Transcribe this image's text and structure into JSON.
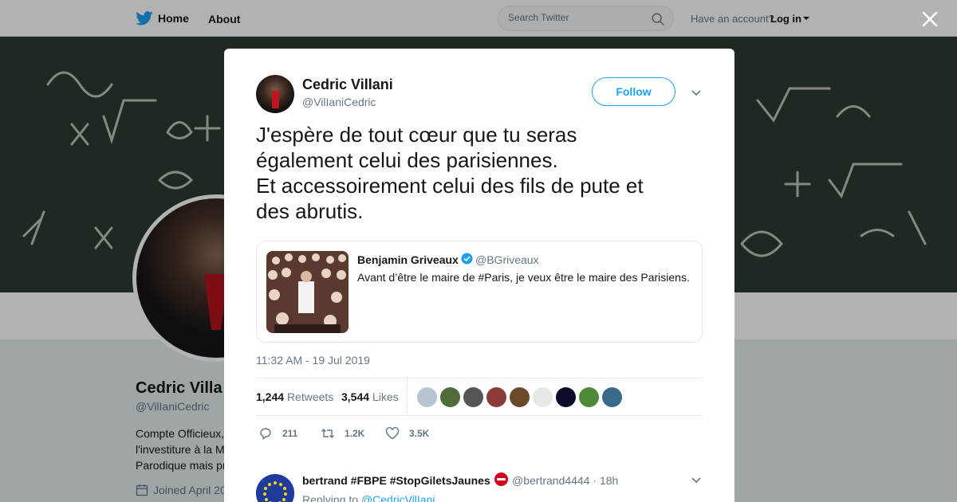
{
  "topbar": {
    "home_label": "Home",
    "about_label": "About",
    "search_placeholder": "Search Twitter",
    "have_account": "Have an account?",
    "login_label": "Log in"
  },
  "profile": {
    "name": "Cedric Villa",
    "handle": "@VilIaniCedric",
    "bio_lines": [
      "Compte Officieux,",
      "l'investiture à la M",
      "Parodique mais pr"
    ],
    "joined": "Joined April 20"
  },
  "tweet": {
    "author_name": "Cedric Villani",
    "author_handle": "@VilIaniCedric",
    "follow_label": "Follow",
    "text_lines": [
      "J'espère de tout cœur que tu seras",
      "également celui des parisiennes.",
      "Et accessoirement celui des fils de pute et",
      "des abrutis."
    ],
    "quote": {
      "name": "Benjamin Griveaux",
      "handle": "@BGriveaux",
      "text": "Avant d’être le maire de #Paris, je veux être le maire des Parisiens."
    },
    "timestamp": "11:32 AM - 19 Jul 2019",
    "retweets_count": "1,244",
    "retweets_label": "Retweets",
    "likes_count": "3,544",
    "likes_label": "Likes",
    "likers_colors": [
      "#b8c4d0",
      "#4f6b3a",
      "#555555",
      "#8c3a3a",
      "#6b4a2a",
      "#e8e8e8",
      "#0b0b2a",
      "#4c8a3a",
      "#3a6a8a"
    ],
    "actions": {
      "replies": "211",
      "retweets": "1.2K",
      "likes": "3.5K"
    }
  },
  "reply": {
    "name": "bertrand #FBPE #StopGiletsJaunes",
    "handle": "@bertrand4444 · 18h",
    "replying_prefix": "Replying to",
    "replying_to": "@CedricVilIani"
  },
  "colors": {
    "accent": "#1da1f2",
    "verified": "#1da1f2",
    "text_primary": "#14171a",
    "text_secondary": "#657786"
  }
}
